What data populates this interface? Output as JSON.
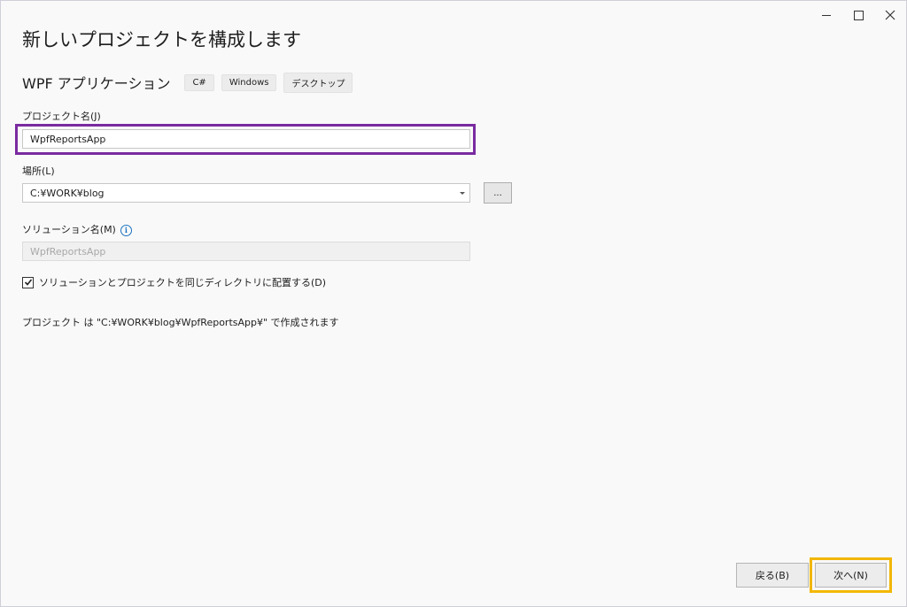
{
  "title": "新しいプロジェクトを構成します",
  "template": {
    "name": "WPF アプリケーション",
    "tags": [
      "C#",
      "Windows",
      "デスクトップ"
    ]
  },
  "project_name": {
    "label": "プロジェクト名(J)",
    "value": "WpfReportsApp"
  },
  "location": {
    "label": "場所(L)",
    "value": "C:¥WORK¥blog",
    "browse_label": "..."
  },
  "solution_name": {
    "label": "ソリューション名(M)",
    "value": "WpfReportsApp",
    "info_icon": "info-icon"
  },
  "same_dir": {
    "label": "ソリューションとプロジェクトを同じディレクトリに配置する(D)",
    "checked": true
  },
  "path_message": "プロジェクト は \"C:¥WORK¥blog¥WpfReportsApp¥\" で作成されます",
  "buttons": {
    "back": "戻る(B)",
    "next": "次へ(N)"
  },
  "colors": {
    "highlight_project_name": "#7a2aa0",
    "highlight_next": "#f2b705",
    "info_icon": "#1a73c0"
  }
}
